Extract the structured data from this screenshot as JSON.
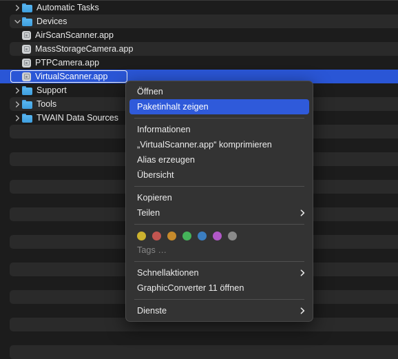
{
  "list": {
    "rows": [
      {
        "type": "folder",
        "label": "Automatic Tasks",
        "disclosure": "right",
        "striped": false,
        "selected": false,
        "indent": false
      },
      {
        "type": "folder",
        "label": "Devices",
        "disclosure": "down",
        "striped": true,
        "selected": false,
        "indent": false
      },
      {
        "type": "app",
        "label": "AirScanScanner.app",
        "disclosure": "none",
        "striped": false,
        "selected": false,
        "indent": true
      },
      {
        "type": "app",
        "label": "MassStorageCamera.app",
        "disclosure": "none",
        "striped": true,
        "selected": false,
        "indent": true
      },
      {
        "type": "app",
        "label": "PTPCamera.app",
        "disclosure": "none",
        "striped": false,
        "selected": false,
        "indent": true
      },
      {
        "type": "app",
        "label": "VirtualScanner.app",
        "disclosure": "none",
        "striped": false,
        "selected": true,
        "indent": true
      },
      {
        "type": "folder",
        "label": "Support",
        "disclosure": "right",
        "striped": false,
        "selected": false,
        "indent": false
      },
      {
        "type": "folder",
        "label": "Tools",
        "disclosure": "right",
        "striped": true,
        "selected": false,
        "indent": false
      },
      {
        "type": "folder",
        "label": "TWAIN Data Sources",
        "disclosure": "right",
        "striped": false,
        "selected": false,
        "indent": false
      },
      {
        "type": "empty",
        "label": "",
        "disclosure": "none",
        "striped": true,
        "selected": false,
        "indent": false
      },
      {
        "type": "empty",
        "label": "",
        "disclosure": "none",
        "striped": false,
        "selected": false,
        "indent": false
      },
      {
        "type": "empty",
        "label": "",
        "disclosure": "none",
        "striped": true,
        "selected": false,
        "indent": false
      },
      {
        "type": "empty",
        "label": "",
        "disclosure": "none",
        "striped": false,
        "selected": false,
        "indent": false
      },
      {
        "type": "empty",
        "label": "",
        "disclosure": "none",
        "striped": true,
        "selected": false,
        "indent": false
      },
      {
        "type": "empty",
        "label": "",
        "disclosure": "none",
        "striped": false,
        "selected": false,
        "indent": false
      },
      {
        "type": "empty",
        "label": "",
        "disclosure": "none",
        "striped": true,
        "selected": false,
        "indent": false
      },
      {
        "type": "empty",
        "label": "",
        "disclosure": "none",
        "striped": false,
        "selected": false,
        "indent": false
      },
      {
        "type": "empty",
        "label": "",
        "disclosure": "none",
        "striped": true,
        "selected": false,
        "indent": false
      },
      {
        "type": "empty",
        "label": "",
        "disclosure": "none",
        "striped": false,
        "selected": false,
        "indent": false
      },
      {
        "type": "empty",
        "label": "",
        "disclosure": "none",
        "striped": true,
        "selected": false,
        "indent": false
      },
      {
        "type": "empty",
        "label": "",
        "disclosure": "none",
        "striped": false,
        "selected": false,
        "indent": false
      },
      {
        "type": "empty",
        "label": "",
        "disclosure": "none",
        "striped": true,
        "selected": false,
        "indent": false
      },
      {
        "type": "empty",
        "label": "",
        "disclosure": "none",
        "striped": false,
        "selected": false,
        "indent": false
      },
      {
        "type": "empty",
        "label": "",
        "disclosure": "none",
        "striped": true,
        "selected": false,
        "indent": false
      },
      {
        "type": "empty",
        "label": "",
        "disclosure": "none",
        "striped": false,
        "selected": false,
        "indent": false
      },
      {
        "type": "empty",
        "label": "",
        "disclosure": "none",
        "striped": true,
        "selected": false,
        "indent": false
      }
    ]
  },
  "context_menu": {
    "items": [
      {
        "kind": "item",
        "label": "Öffnen",
        "highlight": false,
        "submenu": false,
        "dim": false
      },
      {
        "kind": "item",
        "label": "Paketinhalt zeigen",
        "highlight": true,
        "submenu": false,
        "dim": false
      },
      {
        "kind": "separator"
      },
      {
        "kind": "item",
        "label": "Informationen",
        "highlight": false,
        "submenu": false,
        "dim": false
      },
      {
        "kind": "item",
        "label": "„VirtualScanner.app“ komprimieren",
        "highlight": false,
        "submenu": false,
        "dim": false
      },
      {
        "kind": "item",
        "label": "Alias erzeugen",
        "highlight": false,
        "submenu": false,
        "dim": false
      },
      {
        "kind": "item",
        "label": "Übersicht",
        "highlight": false,
        "submenu": false,
        "dim": false
      },
      {
        "kind": "separator"
      },
      {
        "kind": "item",
        "label": "Kopieren",
        "highlight": false,
        "submenu": false,
        "dim": false
      },
      {
        "kind": "item",
        "label": "Teilen",
        "highlight": false,
        "submenu": true,
        "dim": false
      },
      {
        "kind": "separator"
      },
      {
        "kind": "tags"
      },
      {
        "kind": "item",
        "label": "Tags …",
        "highlight": false,
        "submenu": false,
        "dim": true
      },
      {
        "kind": "separator"
      },
      {
        "kind": "item",
        "label": "Schnellaktionen",
        "highlight": false,
        "submenu": true,
        "dim": false
      },
      {
        "kind": "item",
        "label": "GraphicConverter 11 öffnen",
        "highlight": false,
        "submenu": false,
        "dim": false
      },
      {
        "kind": "separator"
      },
      {
        "kind": "item",
        "label": "Dienste",
        "highlight": false,
        "submenu": true,
        "dim": false
      }
    ],
    "tag_colors": [
      {
        "name": "yellow",
        "hex": "#ccb22e"
      },
      {
        "name": "red",
        "hex": "#c25550"
      },
      {
        "name": "orange",
        "hex": "#c68a2b"
      },
      {
        "name": "green",
        "hex": "#45b35a"
      },
      {
        "name": "blue",
        "hex": "#3b7ec0"
      },
      {
        "name": "purple",
        "hex": "#b158c7"
      },
      {
        "name": "gray",
        "hex": "#8a8a8a"
      }
    ],
    "highlight_color": "#2f5ada"
  },
  "theme": {
    "background": "#1c1c1c",
    "stripe": "#2a2a2a",
    "selection": "#2a56d6",
    "menu_background": "#333333",
    "text": "#e9e9e9"
  }
}
